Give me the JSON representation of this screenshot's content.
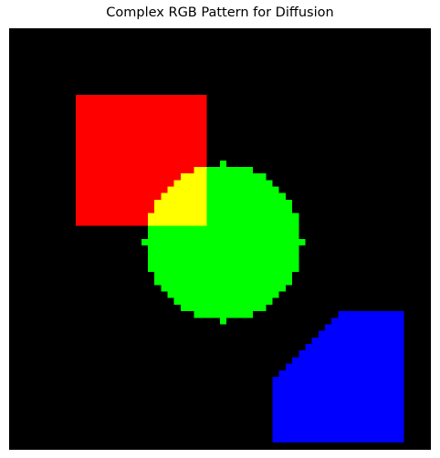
{
  "figure": {
    "title": "Complex RGB Pattern for Diffusion"
  },
  "image": {
    "grid_size": 64,
    "background_color": "#000000",
    "shapes": [
      {
        "name": "red-square",
        "color": "#ff0000"
      },
      {
        "name": "green-circle",
        "color": "#00ff00"
      },
      {
        "name": "yellow-overlap",
        "color": "#ffff00"
      },
      {
        "name": "blue-polygon",
        "color": "#0000ff"
      }
    ]
  }
}
